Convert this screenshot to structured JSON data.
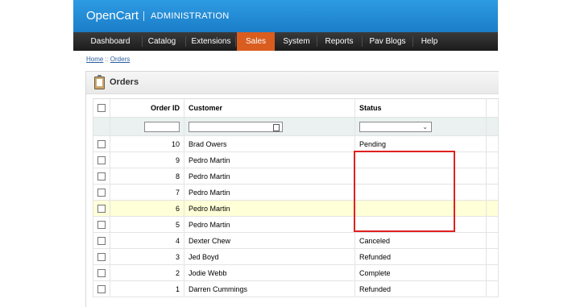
{
  "app": {
    "logo": "OpenCart",
    "subtitle": "ADMINISTRATION"
  },
  "nav": {
    "items": [
      "Dashboard",
      "Catalog",
      "Extensions",
      "Sales",
      "System",
      "Reports",
      "Pav Blogs",
      "Help"
    ],
    "active": "Sales"
  },
  "breadcrumb": {
    "home": "Home",
    "separator": "::",
    "current": "Orders"
  },
  "page": {
    "title": "Orders"
  },
  "table": {
    "headers": {
      "order_id": "Order ID",
      "customer": "Customer",
      "status": "Status"
    },
    "rows": [
      {
        "id": "10",
        "customer": "Brad Owers",
        "status": "Pending"
      },
      {
        "id": "9",
        "customer": "Pedro Martin",
        "status": ""
      },
      {
        "id": "8",
        "customer": "Pedro Martin",
        "status": ""
      },
      {
        "id": "7",
        "customer": "Pedro Martin",
        "status": ""
      },
      {
        "id": "6",
        "customer": "Pedro Martin",
        "status": ""
      },
      {
        "id": "5",
        "customer": "Pedro Martin",
        "status": ""
      },
      {
        "id": "4",
        "customer": "Dexter Chew",
        "status": "Canceled"
      },
      {
        "id": "3",
        "customer": "Jed Boyd",
        "status": "Refunded"
      },
      {
        "id": "2",
        "customer": "Jodie Webb",
        "status": "Complete"
      },
      {
        "id": "1",
        "customer": "Darren Cummings",
        "status": "Refunded"
      }
    ]
  },
  "colors": {
    "header_blue": "#1b7dc8",
    "nav_active": "#d95d1f",
    "row_highlight": "#ffffd8",
    "annotation_red": "#e02020"
  }
}
